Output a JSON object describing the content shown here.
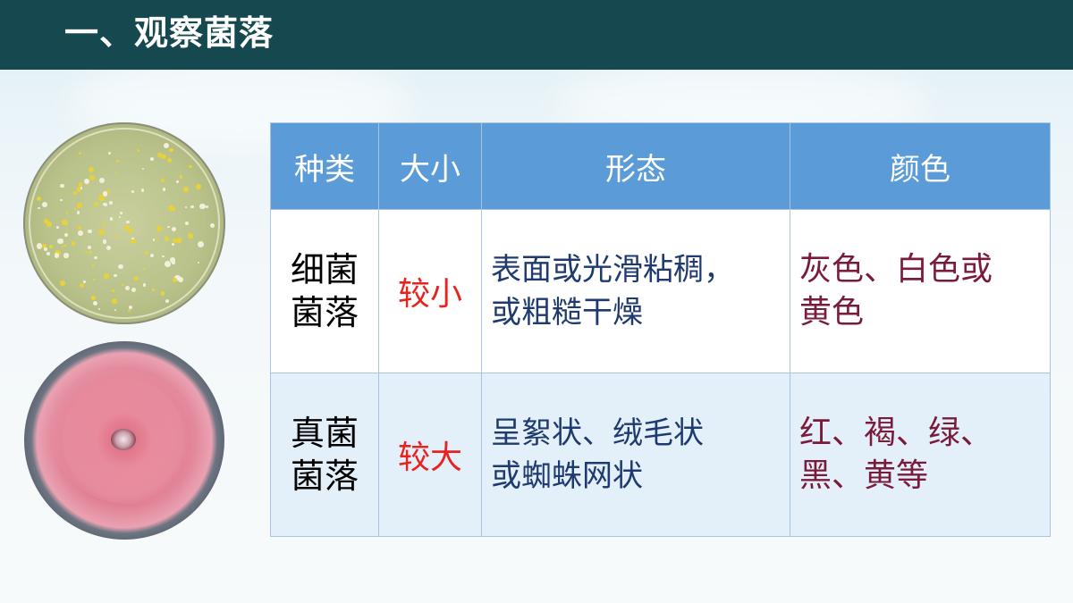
{
  "slide": {
    "title": "一、观察菌落"
  },
  "images": {
    "bacteria_dish": "bacterial-colony-petri-dish",
    "fungus_dish": "fungal-colony-petri-dish"
  },
  "table": {
    "headers": [
      "种类",
      "大小",
      "形态",
      "颜色"
    ],
    "rows": [
      {
        "kind_line1": "细菌",
        "kind_line2": "菌落",
        "size": "较小",
        "form_line1": "表面或光滑粘稠，",
        "form_line2": "或粗糙干燥",
        "color_line1": "灰色、白色或",
        "color_line2": "黄色"
      },
      {
        "kind_line1": "真菌",
        "kind_line2": "菌落",
        "size": "较大",
        "form_line1": "呈絮状、绒毛状",
        "form_line2": "或蜘蛛网状",
        "color_line1": "红、褐、绿、",
        "color_line2": "黑、黄等"
      }
    ]
  },
  "colors": {
    "header_bar": "#15494f",
    "table_header": "#5b9bd8",
    "size_text": "#e8231f",
    "form_text": "#1e3a6e",
    "color_text": "#7a1b3a"
  }
}
